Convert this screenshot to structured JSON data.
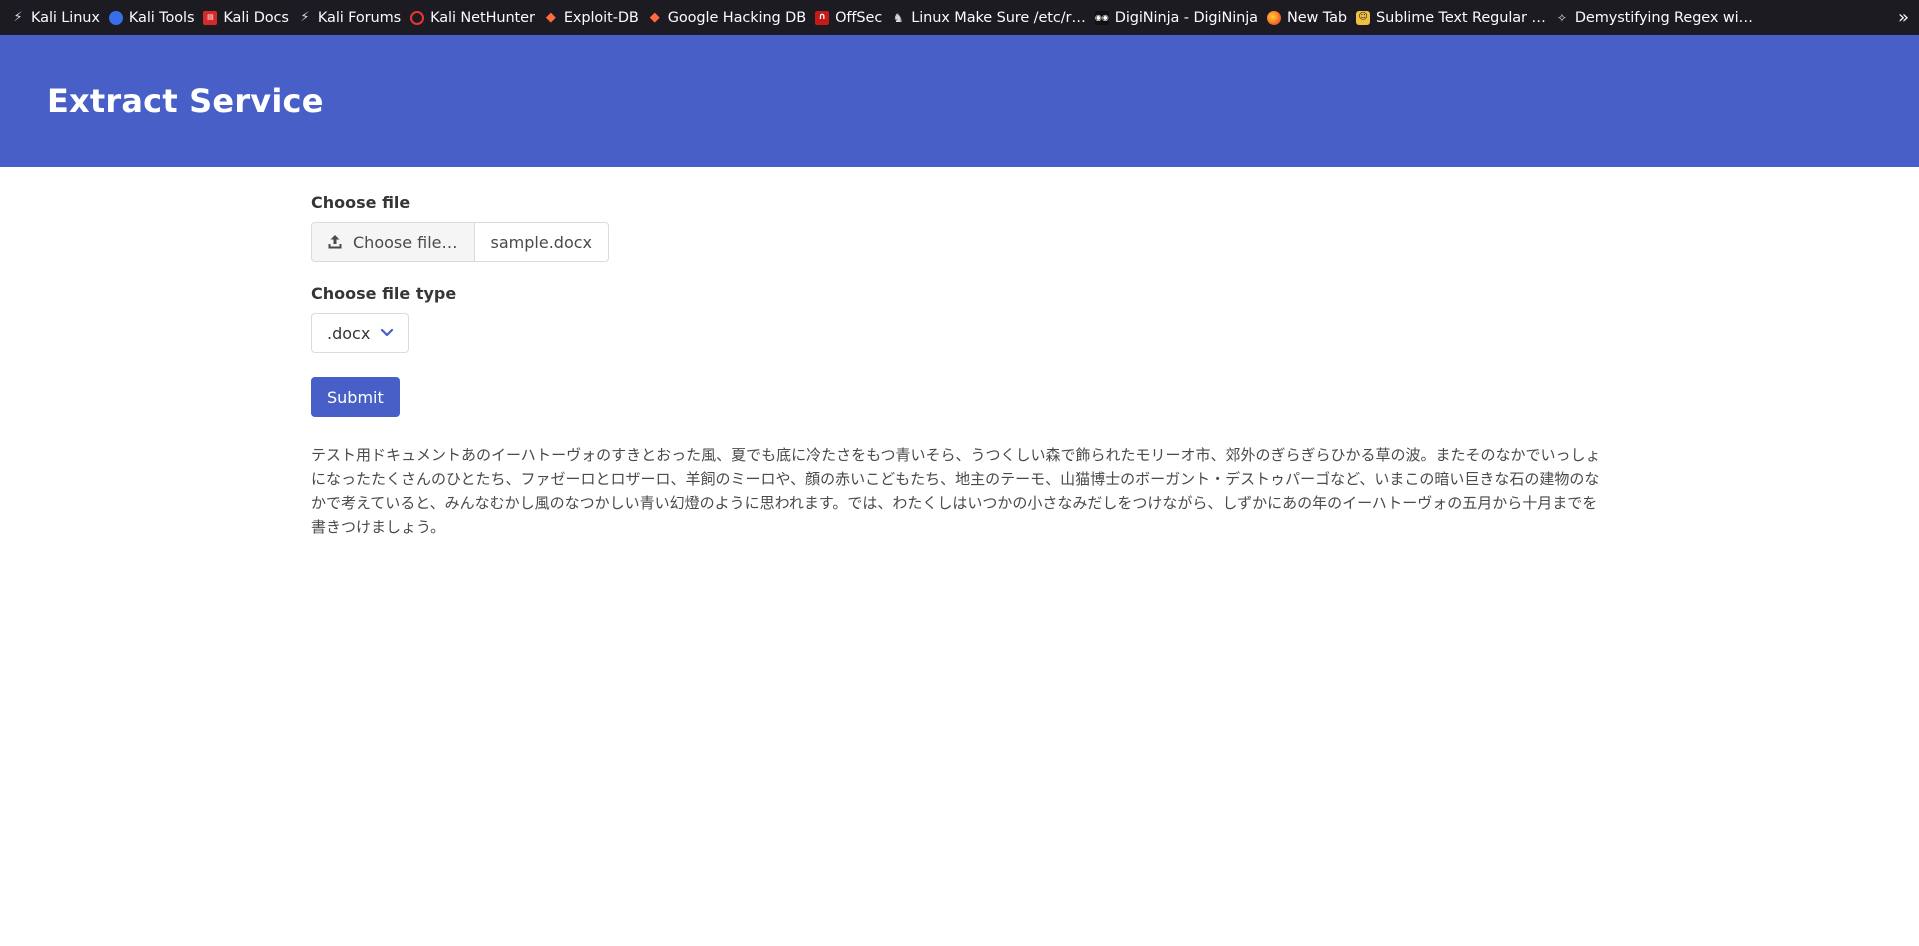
{
  "bookmarks": [
    {
      "label": "Kali Linux",
      "icon": "kali-dragon-icon"
    },
    {
      "label": "Kali Tools",
      "icon": "kali-tools-icon"
    },
    {
      "label": "Kali Docs",
      "icon": "kali-docs-icon"
    },
    {
      "label": "Kali Forums",
      "icon": "kali-dragon-icon"
    },
    {
      "label": "Kali NetHunter",
      "icon": "nethunter-icon"
    },
    {
      "label": "Exploit-DB",
      "icon": "exploit-db-icon"
    },
    {
      "label": "Google Hacking DB",
      "icon": "exploit-db-icon"
    },
    {
      "label": "OffSec",
      "icon": "offsec-icon"
    },
    {
      "label": "Linux Make Sure /etc/r…",
      "icon": "linux-icon"
    },
    {
      "label": "DigiNinja - DigiNinja",
      "icon": "digininja-icon"
    },
    {
      "label": "New Tab",
      "icon": "firefox-icon"
    },
    {
      "label": "Sublime Text Regular …",
      "icon": "sublime-icon"
    },
    {
      "label": "Demystifying Regex wi…",
      "icon": "regex-icon"
    }
  ],
  "bookmarks_overflow": "»",
  "hero": {
    "title": "Extract Service"
  },
  "form": {
    "file_label": "Choose file",
    "file_button": "Choose file…",
    "file_name": "sample.docx",
    "type_label": "Choose file type",
    "type_value": ".docx",
    "submit_label": "Submit"
  },
  "output": {
    "text": "テスト用ドキュメントあのイーハトーヴォのすきとおった風、夏でも底に冷たさをもつ青いそら、うつくしい森で飾られたモリーオ市、郊外のぎらぎらひかる草の波。またそのなかでいっしょになったたくさんのひとたち、ファゼーロとロザーロ、羊飼のミーロや、顔の赤いこどもたち、地主のテーモ、山猫博士のボーガント・デストゥパーゴなど、いまこの暗い巨きな石の建物のなかで考えていると、みんなむかし風のなつかしい青い幻燈のように思われます。では、わたくしはいつかの小さなみだしをつけながら、しずかにあの年のイーハトーヴォの五月から十月までを書きつけましょう。"
  },
  "colors": {
    "toolbar_bg": "#1c1b22",
    "hero_bg": "#485fc7",
    "primary": "#485fc7"
  }
}
